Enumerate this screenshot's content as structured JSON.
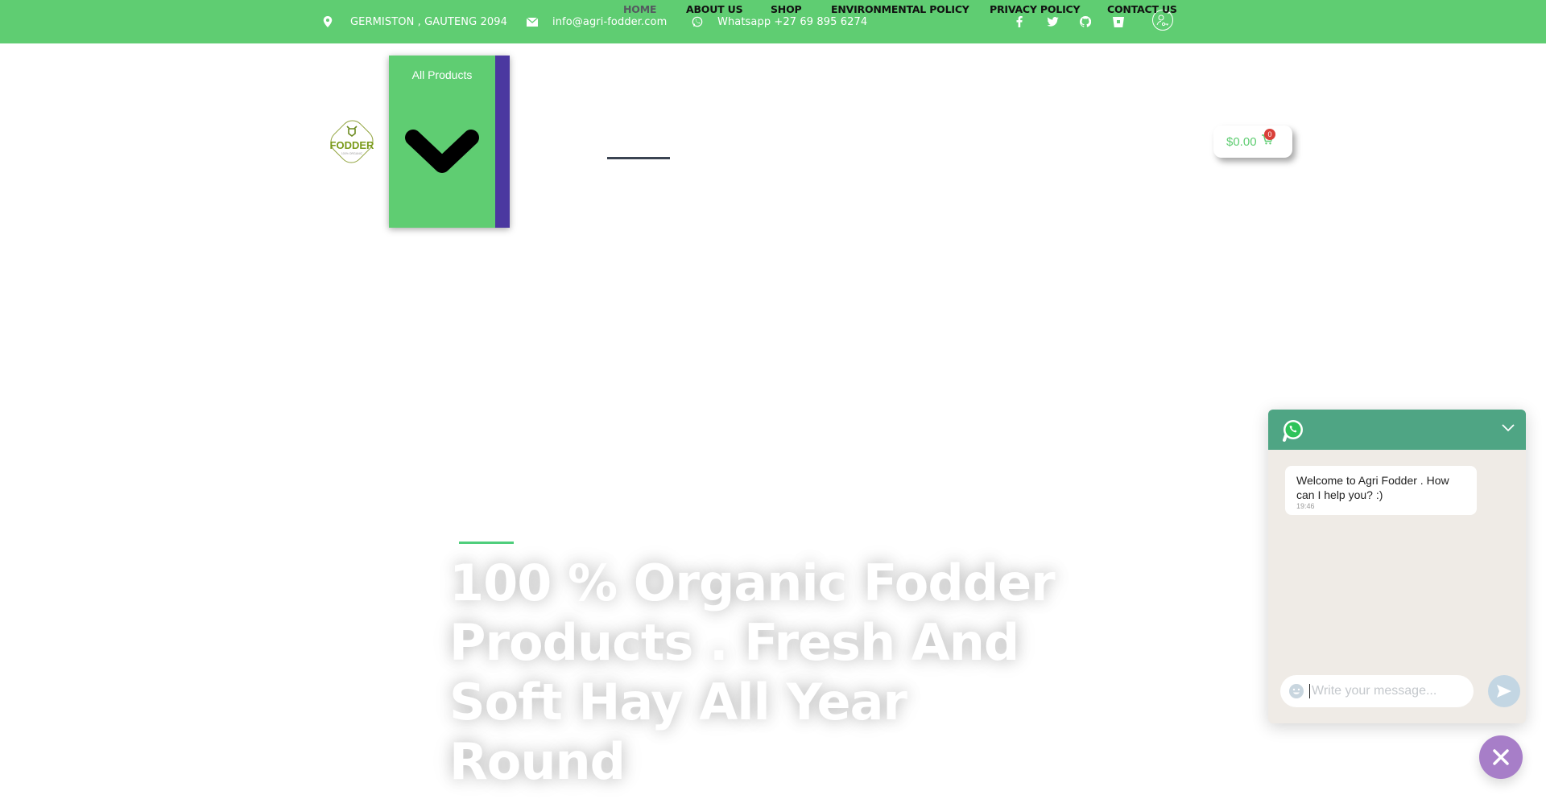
{
  "topbar": {
    "address": "GERMISTON , GAUTENG 2094",
    "email": "info@agri-fodder.com",
    "whatsapp": "Whatsapp +27 69 895 6274",
    "social": [
      "facebook-icon",
      "twitter-icon",
      "github-icon",
      "bitbucket-icon"
    ],
    "login_icon": "user-key-icon"
  },
  "header": {
    "logo": {
      "name": "FODDER",
      "tagline": "100% ORGANIC"
    },
    "all_products": {
      "label": "All Products",
      "icon": "chevron-down-icon"
    },
    "nav": [
      {
        "label": "HOME",
        "active": true
      },
      {
        "label": "ABOUT US"
      },
      {
        "label": "SHOP"
      },
      {
        "label": "ENVIRONMENTAL POLICY"
      },
      {
        "label": "PRIVACY POLICY"
      },
      {
        "label": "CONTACT US"
      }
    ],
    "cart": {
      "amount": "$0.00",
      "count": "0"
    }
  },
  "hero": {
    "title": "100 % Organic Fodder Products . Fresh And Soft Hay All Year Round"
  },
  "whatsapp_widget": {
    "message": "Welcome to Agri Fodder . How can I help you? :)",
    "time": "19:46",
    "input_placeholder": "Write your message...",
    "input_value": ""
  },
  "colors": {
    "brand_green": "#5fcd72",
    "accent_purple": "#4b38a0",
    "whatsapp_green": "#4fa584",
    "close_button": "#a77ec8",
    "badge_red": "#d9403a"
  }
}
